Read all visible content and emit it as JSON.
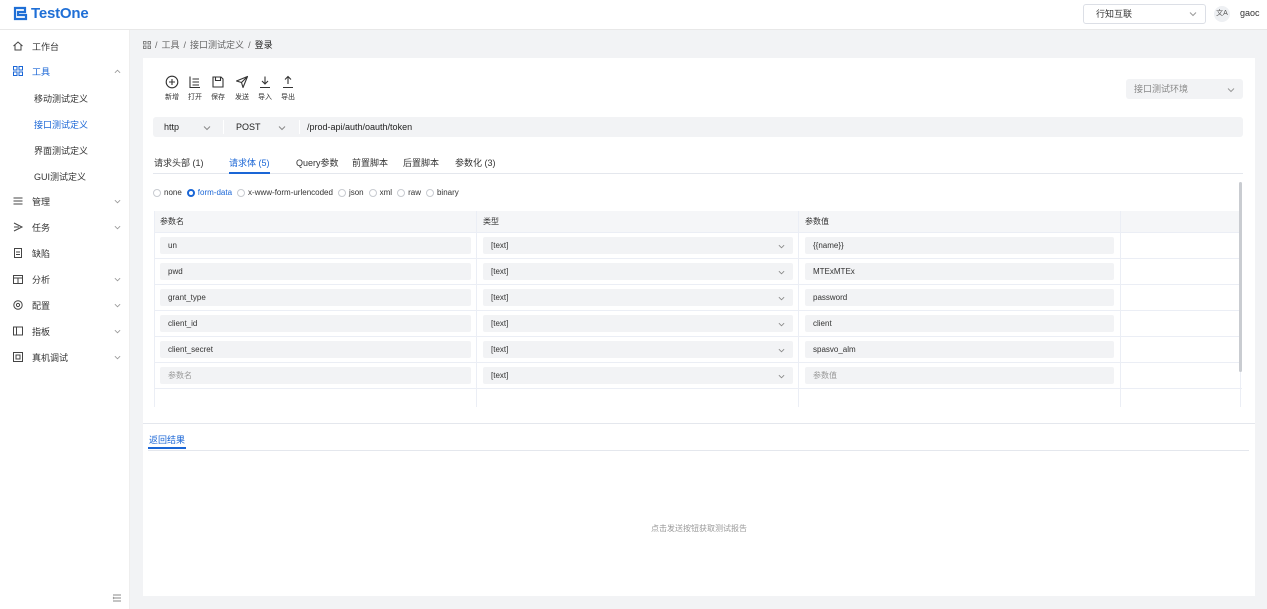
{
  "app": {
    "name": "TestOne"
  },
  "header": {
    "org": "行知互联",
    "user": "gaoc",
    "lang_icon": "文A"
  },
  "sidebar": {
    "items": [
      {
        "label": "工作台"
      },
      {
        "label": "工具"
      },
      {
        "label": "管理"
      },
      {
        "label": "任务"
      },
      {
        "label": "缺陷"
      },
      {
        "label": "分析"
      },
      {
        "label": "配置"
      },
      {
        "label": "指板"
      },
      {
        "label": "真机调试"
      }
    ],
    "tool_children": [
      {
        "label": "移动测试定义"
      },
      {
        "label": "接口测试定义"
      },
      {
        "label": "界面测试定义"
      },
      {
        "label": "GUI测试定义"
      }
    ]
  },
  "breadcrumb": {
    "root": "工具",
    "parent": "接口测试定义",
    "current": "登录"
  },
  "toolbar": {
    "new": "新增",
    "open": "打开",
    "save": "保存",
    "send": "发送",
    "import": "导入",
    "export": "导出"
  },
  "env_select": {
    "placeholder": "接口测试环境"
  },
  "request": {
    "protocol": "http",
    "method": "POST",
    "url": "/prod-api/auth/oauth/token"
  },
  "tabs": [
    "请求头部 (1)",
    "请求体 (5)",
    "Query参数",
    "前置脚本",
    "后置脚本",
    "参数化 (3)"
  ],
  "body_types": [
    "none",
    "form-data",
    "x-www-form-urlencoded",
    "json",
    "xml",
    "raw",
    "binary"
  ],
  "body_selected": "form-data",
  "table": {
    "headers": {
      "name": "参数名",
      "type": "类型",
      "value": "参数值"
    },
    "rows": [
      {
        "name": "un",
        "type": "[text]",
        "value": "{{name}}"
      },
      {
        "name": "pwd",
        "type": "[text]",
        "value": "MTExMTEx"
      },
      {
        "name": "grant_type",
        "type": "[text]",
        "value": "password"
      },
      {
        "name": "client_id",
        "type": "[text]",
        "value": "client"
      },
      {
        "name": "client_secret",
        "type": "[text]",
        "value": "spasvo_alm"
      }
    ],
    "new_row": {
      "name_placeholder": "参数名",
      "type": "[text]",
      "value_placeholder": "参数值"
    }
  },
  "result": {
    "tab": "返回结果",
    "empty": "点击发送按钮获取测试报告"
  }
}
